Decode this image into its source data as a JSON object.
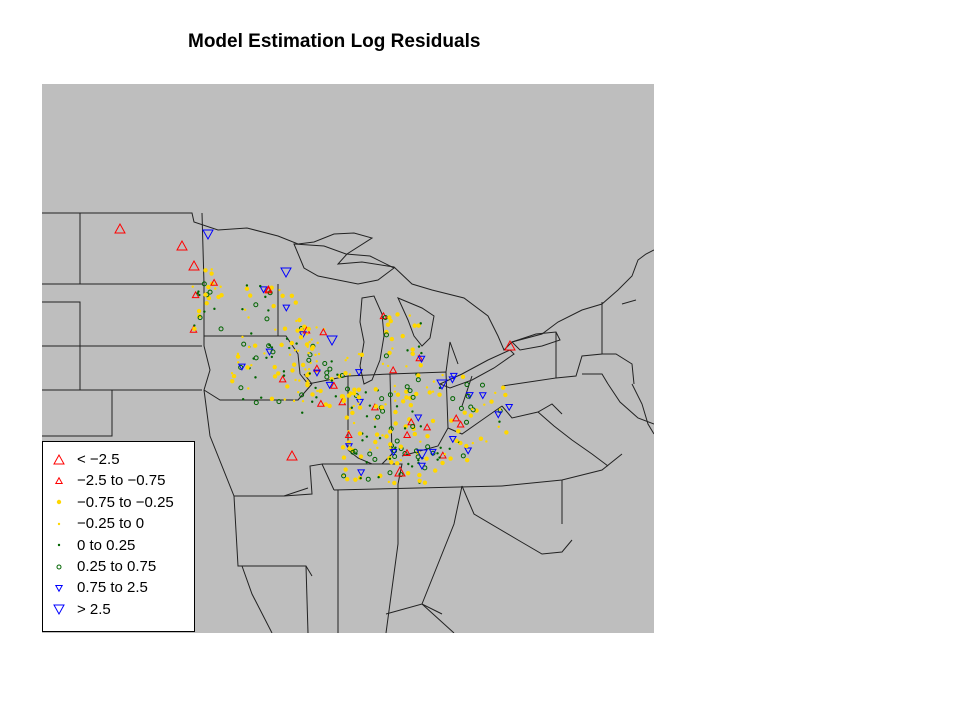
{
  "title": "Model Estimation Log Residuals",
  "colors": {
    "background": "#bebebe",
    "border": "#222222",
    "red": "#ff0000",
    "yellow": "#ffd700",
    "green": "#006400",
    "blue": "#0000ff"
  },
  "legend": {
    "items": [
      {
        "label": "< −2.5",
        "symbol": "triangle-up-large",
        "color": "#ff0000"
      },
      {
        "label": "−2.5 to −0.75",
        "symbol": "triangle-up-small",
        "color": "#ff0000"
      },
      {
        "label": "−0.75 to −0.25",
        "symbol": "dot-large",
        "color": "#ffd700"
      },
      {
        "label": "−0.25 to 0",
        "symbol": "dot-small",
        "color": "#ffd700"
      },
      {
        "label": "0 to 0.25",
        "symbol": "dot-small",
        "color": "#006400"
      },
      {
        "label": "0.25 to 0.75",
        "symbol": "circle-open",
        "color": "#006400"
      },
      {
        "label": "0.75 to 2.5",
        "symbol": "triangle-down-small",
        "color": "#0000ff"
      },
      {
        "label": "> 2.5",
        "symbol": "triangle-down-large",
        "color": "#0000ff"
      }
    ]
  }
}
